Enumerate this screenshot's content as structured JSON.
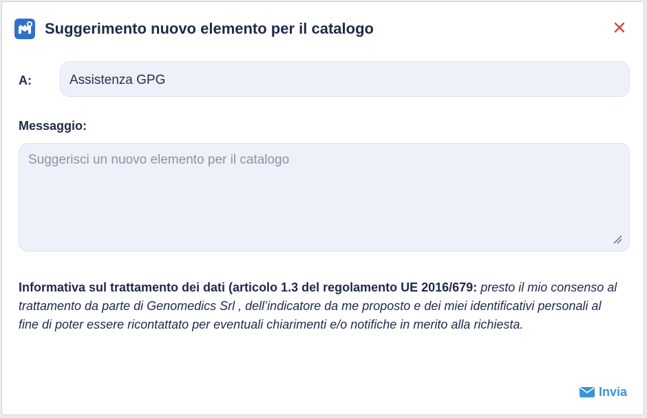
{
  "dialog": {
    "title": "Suggerimento nuovo elemento per il catalogo",
    "app_icon": "app-logo-icon",
    "close_icon": "close-icon"
  },
  "to": {
    "label": "A:",
    "value": "Assistenza GPG"
  },
  "message": {
    "label": "Messaggio:",
    "placeholder": "Suggerisci un nuovo elemento per il catalogo"
  },
  "privacy": {
    "bold_text": "Informativa sul trattamento dei dati (articolo 1.3 del regolamento UE 2016/679:",
    "italic_text": " presto il mio consenso al trattamento da parte di Genomedics Srl , dell’indicatore da me proposto e dei miei identificativi personali al fine di poter essere ricontattato per eventuali chiarimenti e/o notifiche in merito alla richiesta."
  },
  "send": {
    "label": "Invia",
    "icon": "envelope-icon"
  },
  "colors": {
    "accent": "#3a93d6",
    "close": "#e0413b",
    "field_bg": "#eef1f9",
    "text_dark": "#1f2a4a"
  }
}
